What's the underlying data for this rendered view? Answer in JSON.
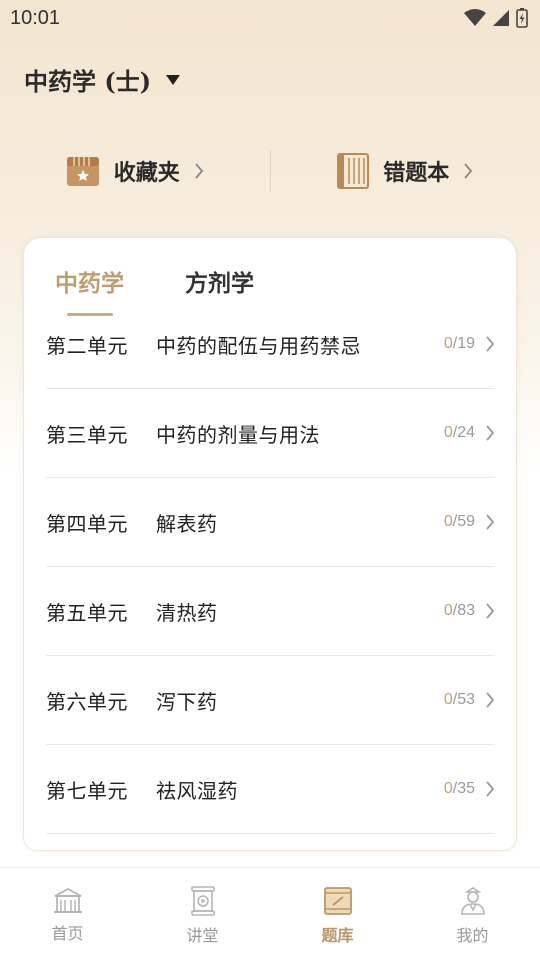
{
  "status_bar": {
    "time": "10:01"
  },
  "header": {
    "subject": "中药学 (士)"
  },
  "quick_links": [
    {
      "label": "收藏夹"
    },
    {
      "label": "错题本"
    }
  ],
  "tabs": [
    {
      "label": "中药学",
      "active": true
    },
    {
      "label": "方剂学",
      "active": false
    }
  ],
  "units": [
    {
      "number": "第二单元",
      "title": "中药的配伍与用药禁忌",
      "done": "0",
      "total": "/19"
    },
    {
      "number": "第三单元",
      "title": "中药的剂量与用法",
      "done": "0",
      "total": "/24"
    },
    {
      "number": "第四单元",
      "title": "解表药",
      "done": "0",
      "total": "/59"
    },
    {
      "number": "第五单元",
      "title": "清热药",
      "done": "0",
      "total": "/83"
    },
    {
      "number": "第六单元",
      "title": "泻下药",
      "done": "0",
      "total": "/53"
    },
    {
      "number": "第七单元",
      "title": "祛风湿药",
      "done": "0",
      "total": "/35"
    }
  ],
  "bottom_nav": [
    {
      "label": "首页",
      "icon": "home-icon",
      "active": false
    },
    {
      "label": "讲堂",
      "icon": "lecture-icon",
      "active": false
    },
    {
      "label": "题库",
      "icon": "question-bank-icon",
      "active": true
    },
    {
      "label": "我的",
      "icon": "profile-icon",
      "active": false
    }
  ],
  "colors": {
    "accent": "#bf9d6c",
    "header_bg": "#f3e5cf"
  }
}
